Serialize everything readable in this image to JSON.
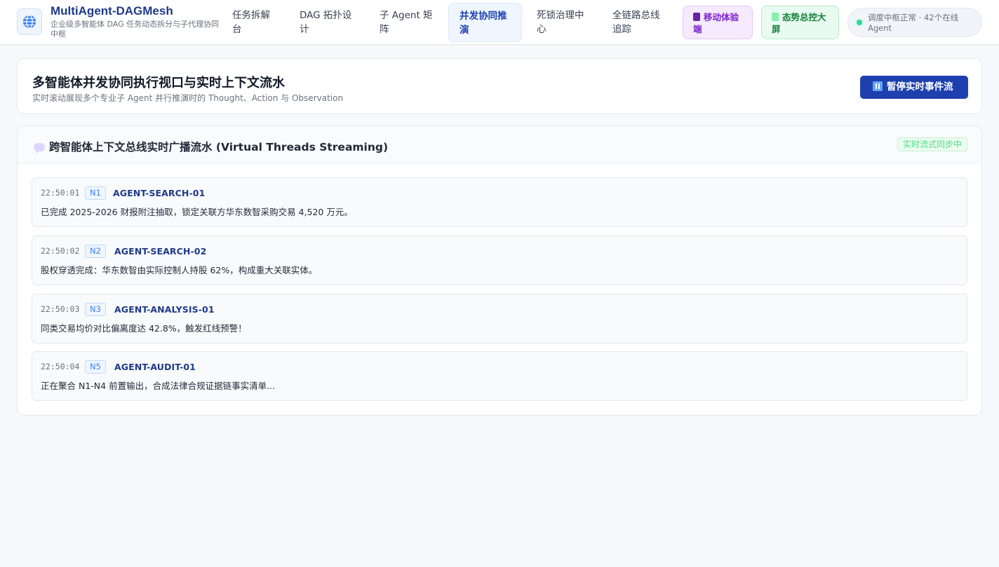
{
  "header": {
    "app_title": "MultiAgent-DAGMesh",
    "app_subtitle": "企业级多智能体 DAG 任务动态拆分与子代理协同中枢",
    "nav": [
      {
        "label": "任务拆解台",
        "active": false
      },
      {
        "label": "DAG 拓扑设计",
        "active": false
      },
      {
        "label": "子 Agent 矩阵",
        "active": false
      },
      {
        "label": "并发协同推演",
        "active": true
      },
      {
        "label": "死锁治理中心",
        "active": false
      },
      {
        "label": "全链路总线追踪",
        "active": false
      }
    ],
    "mobile_button": "移动体验端",
    "screen_button": "态势总控大屏",
    "status_text": "调度中枢正常 · 42个在线 Agent",
    "icons": {
      "logo": "globe-icon",
      "mobile": "phone-icon",
      "screen": "bar-chart-icon",
      "status": "status-dot-icon"
    }
  },
  "page": {
    "title": "多智能体并发协同执行视口与实时上下文流水",
    "subtitle": "实时滚动展现多个专业子 Agent 并行推演时的 Thought、Action 与 Observation",
    "pause_button": "暂停实时事件流"
  },
  "stream": {
    "title": "跨智能体上下文总线实时广播流水 (Virtual Threads Streaming)",
    "sync_badge": "实时流式同步中",
    "events": [
      {
        "time": "22:50:01",
        "node": "N1",
        "agent": "AGENT-SEARCH-01",
        "message": "已完成 2025-2026 财报附注抽取，锁定关联方华东数智采购交易 4,520 万元。"
      },
      {
        "time": "22:50:02",
        "node": "N2",
        "agent": "AGENT-SEARCH-02",
        "message": "股权穿透完成：华东数智由实际控制人持股 62%，构成重大关联实体。"
      },
      {
        "time": "22:50:03",
        "node": "N3",
        "agent": "AGENT-ANALYSIS-01",
        "message": "同类交易均价对比偏离度达 42.8%，触发红线预警！"
      },
      {
        "time": "22:50:04",
        "node": "N5",
        "agent": "AGENT-AUDIT-01",
        "message": "正在聚合 N1-N4 前置输出，合成法律合规证据链事实清单..."
      }
    ]
  },
  "colors": {
    "brand": "#1e3a8a",
    "primary_button": "#1e40af",
    "active_nav_bg": "#eff6ff",
    "sync_green": "#4ade80",
    "mobile_purple": "#7e22ce",
    "screen_green": "#15803d"
  }
}
